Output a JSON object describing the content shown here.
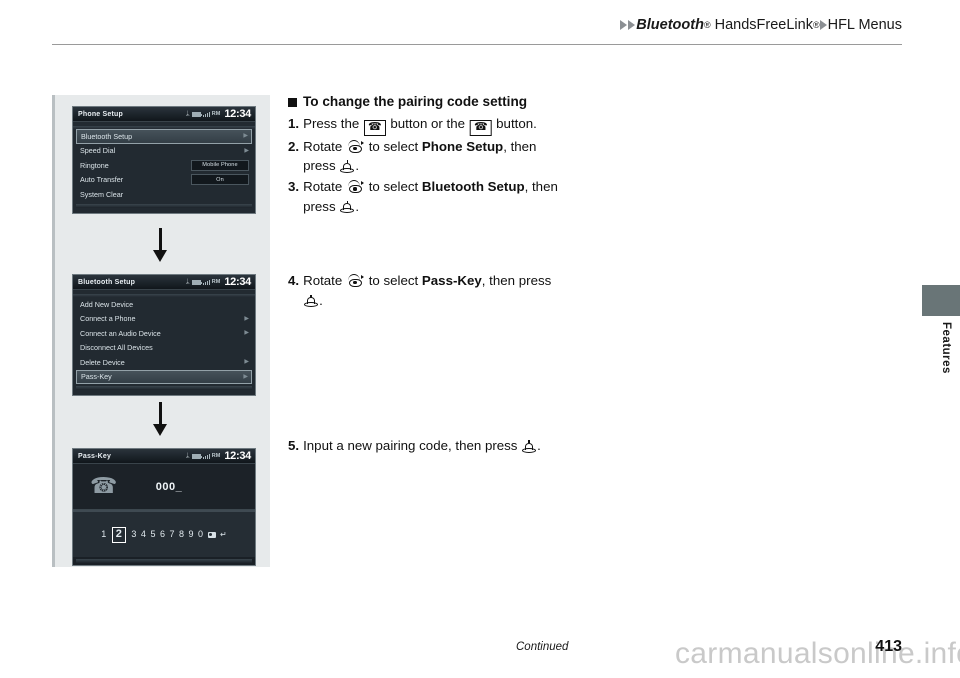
{
  "header": {
    "breadcrumb": [
      {
        "text": "Bluetooth",
        "style": "italic-bold",
        "reg": "®"
      },
      {
        "text": "HandsFreeLink",
        "style": "plain",
        "reg": "®"
      },
      {
        "text": "HFL Menus",
        "style": "plain"
      }
    ],
    "bluetooth_label": "Bluetooth",
    "bluetooth_reg": "®",
    "handsfreelink_label": "HandsFreeLink",
    "handsfreelink_reg": "®",
    "hfl_menus_label": "HFL Menus"
  },
  "side_tab": {
    "label": "Features",
    "color": "#697577"
  },
  "instructions": {
    "section_heading": "To change the pairing code setting",
    "steps": [
      {
        "num": "1.",
        "pre": "Press the",
        "mid": "button or the",
        "post": "button.",
        "icon_1": "phone-pickup-icon",
        "icon_2": "phone-hangup-icon"
      },
      {
        "num": "2.",
        "pre": "Rotate",
        "mid": "to select",
        "target": "Phone Setup",
        "tail": ", then",
        "line2_pre": "press",
        "line2_post": "."
      },
      {
        "num": "3.",
        "pre": "Rotate",
        "mid": "to select",
        "target": "Bluetooth Setup",
        "tail": ", then",
        "line2_pre": "press",
        "line2_post": "."
      },
      {
        "num": "4.",
        "pre": "Rotate",
        "mid": "to select",
        "target": "Pass-Key",
        "tail": ", then press",
        "line2_pre": "",
        "line2_post": "."
      },
      {
        "num": "5.",
        "pre": "Input a new pairing code, then press",
        "post": "."
      }
    ]
  },
  "screens": [
    {
      "id": "phone-setup",
      "title": "Phone Setup",
      "status": {
        "bluetooth": "ᛦ",
        "roaming": "RM",
        "time": "12:34"
      },
      "rows": [
        {
          "label": "Bluetooth Setup",
          "selected": true,
          "chevron": true,
          "value": null
        },
        {
          "label": "Speed Dial",
          "selected": false,
          "chevron": true,
          "value": null
        },
        {
          "label": "Ringtone",
          "selected": false,
          "chevron": false,
          "value": "Mobile Phone"
        },
        {
          "label": "Auto Transfer",
          "selected": false,
          "chevron": false,
          "value": "On"
        },
        {
          "label": "System Clear",
          "selected": false,
          "chevron": false,
          "value": null
        }
      ]
    },
    {
      "id": "bluetooth-setup",
      "title": "Bluetooth Setup",
      "status": {
        "bluetooth": "ᛦ",
        "roaming": "RM",
        "time": "12:34"
      },
      "rows": [
        {
          "label": "Add New Device",
          "selected": false,
          "chevron": false,
          "value": null
        },
        {
          "label": "Connect a Phone",
          "selected": false,
          "chevron": true,
          "value": null
        },
        {
          "label": "Connect an Audio Device",
          "selected": false,
          "chevron": true,
          "value": null
        },
        {
          "label": "Disconnect All Devices",
          "selected": false,
          "chevron": false,
          "value": null
        },
        {
          "label": "Delete Device",
          "selected": false,
          "chevron": true,
          "value": null
        },
        {
          "label": "Pass-Key",
          "selected": true,
          "chevron": true,
          "value": null
        }
      ]
    },
    {
      "id": "pass-key",
      "title": "Pass-Key",
      "status": {
        "bluetooth": "ᛦ",
        "roaming": "RM",
        "time": "12:34"
      },
      "code": "000_",
      "phone_icon": "phone-handset-icon",
      "keypad": [
        "1",
        "2",
        "3",
        "4",
        "5",
        "6",
        "7",
        "8",
        "9",
        "0"
      ],
      "keypad_selected": "2",
      "keypad_backspace": "backspace-icon",
      "keypad_enter": "↵"
    }
  ],
  "footer": {
    "continued": "Continued",
    "page_number": "413",
    "watermark": "carmanualsonline.info"
  }
}
